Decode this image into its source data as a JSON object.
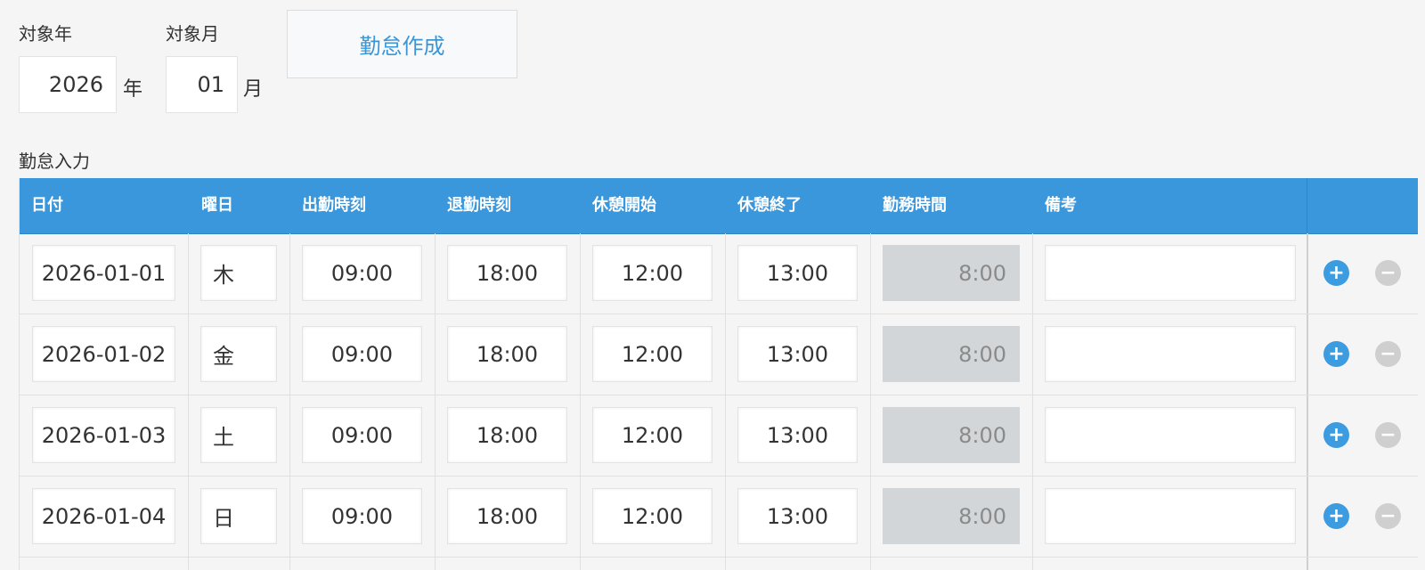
{
  "filters": {
    "year_label": "対象年",
    "year_value": "2026",
    "year_unit": "年",
    "month_label": "対象月",
    "month_value": "01",
    "month_unit": "月",
    "create_button": "勤怠作成"
  },
  "section_title": "勤怠入力",
  "table": {
    "headers": [
      "日付",
      "曜日",
      "出勤時刻",
      "退勤時刻",
      "休憩開始",
      "休憩終了",
      "勤務時間",
      "備考"
    ],
    "rows": [
      {
        "date": "2026-01-01",
        "weekday": "木",
        "start": "09:00",
        "end": "18:00",
        "break_start": "12:00",
        "break_end": "13:00",
        "work_hours": "8:00",
        "note": ""
      },
      {
        "date": "2026-01-02",
        "weekday": "金",
        "start": "09:00",
        "end": "18:00",
        "break_start": "12:00",
        "break_end": "13:00",
        "work_hours": "8:00",
        "note": ""
      },
      {
        "date": "2026-01-03",
        "weekday": "土",
        "start": "09:00",
        "end": "18:00",
        "break_start": "12:00",
        "break_end": "13:00",
        "work_hours": "8:00",
        "note": ""
      },
      {
        "date": "2026-01-04",
        "weekday": "日",
        "start": "09:00",
        "end": "18:00",
        "break_start": "12:00",
        "break_end": "13:00",
        "work_hours": "8:00",
        "note": ""
      }
    ]
  },
  "icons": {
    "add": "plus-circle-icon",
    "remove": "minus-circle-icon"
  },
  "colors": {
    "header_bg": "#3a97dc",
    "accent": "#3b96d6",
    "readonly_bg": "#d3d6d8",
    "add_icon": "#3d9be0",
    "remove_icon": "#cfcfcf"
  }
}
